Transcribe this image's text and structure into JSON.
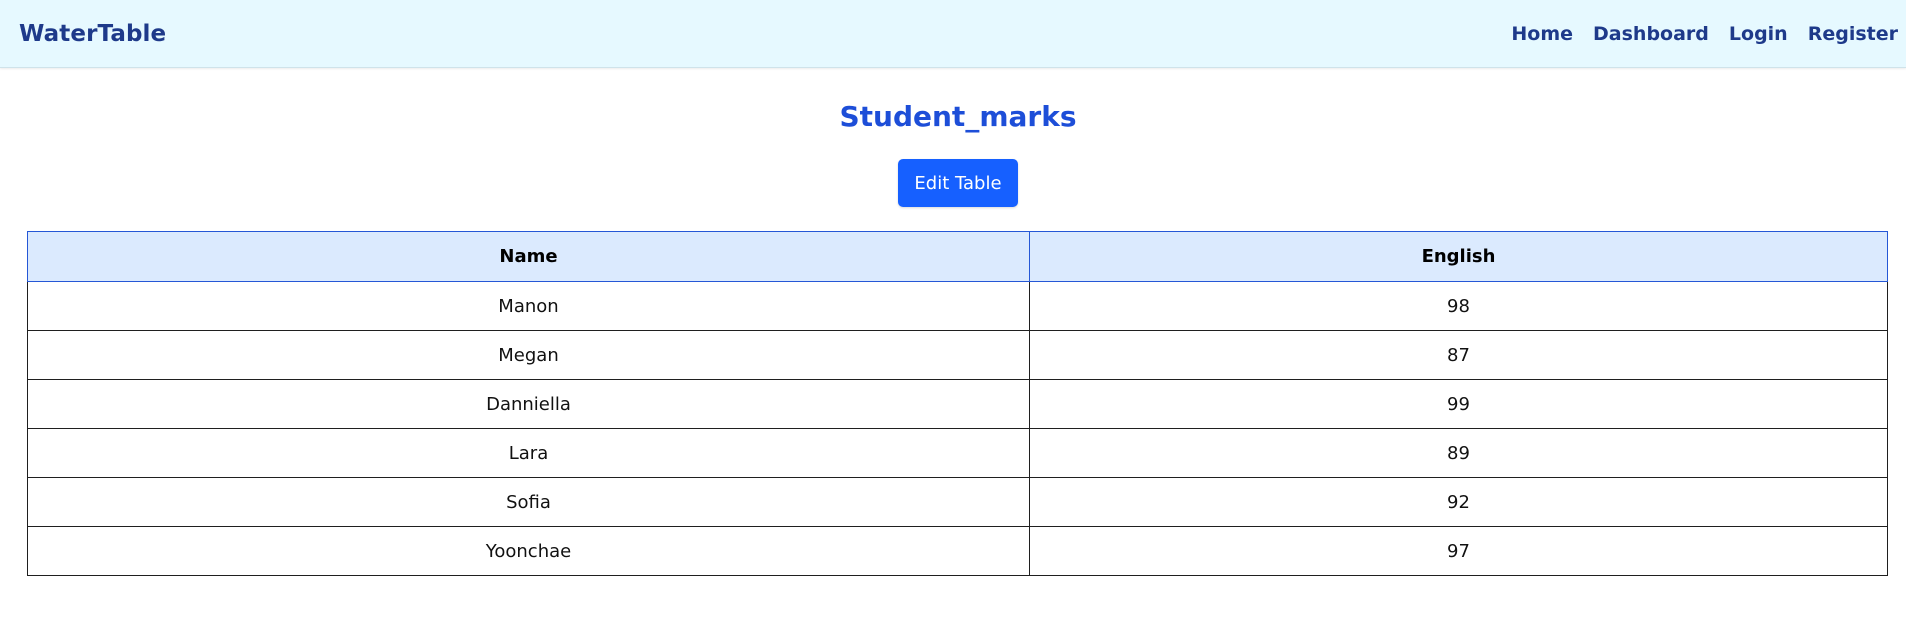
{
  "header": {
    "brand": "WaterTable",
    "nav": [
      "Home",
      "Dashboard",
      "Login",
      "Register"
    ]
  },
  "page": {
    "title": "Student_marks",
    "edit_button_label": "Edit Table"
  },
  "table": {
    "columns": [
      "Name",
      "English"
    ],
    "rows": [
      [
        "Manon",
        "98"
      ],
      [
        "Megan",
        "87"
      ],
      [
        "Danniella",
        "99"
      ],
      [
        "Lara",
        "89"
      ],
      [
        "Sofia",
        "92"
      ],
      [
        "Yoonchae",
        "97"
      ]
    ]
  },
  "colors": {
    "navbar_bg": "#e6f9ff",
    "brand_text": "#1e3a8a",
    "title_text": "#1d4ed8",
    "button_bg": "#1660ff",
    "header_row_bg": "#dbeafe"
  }
}
